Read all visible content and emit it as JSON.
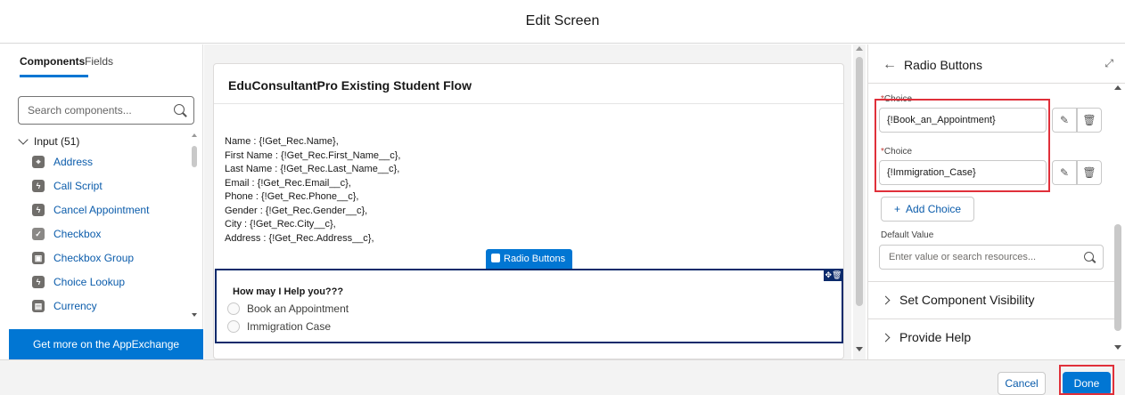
{
  "modal": {
    "title": "Edit Screen"
  },
  "left_panel": {
    "tabs": [
      {
        "label": "Components"
      },
      {
        "label": "Fields"
      }
    ],
    "search": {
      "placeholder": "Search components..."
    },
    "group": {
      "label": "Input (51)"
    },
    "items": [
      {
        "label": "Address",
        "icon": "address-icon"
      },
      {
        "label": "Call Script",
        "icon": "lightning-icon"
      },
      {
        "label": "Cancel Appointment",
        "icon": "lightning-icon"
      },
      {
        "label": "Checkbox",
        "icon": "checkbox-icon"
      },
      {
        "label": "Checkbox Group",
        "icon": "checkbox-group-icon"
      },
      {
        "label": "Choice Lookup",
        "icon": "lightning-icon"
      },
      {
        "label": "Currency",
        "icon": "currency-icon"
      }
    ],
    "appexchange_label": "Get more on the AppExchange"
  },
  "canvas": {
    "card_title": "EduConsultantPro Existing Student Flow",
    "display_lines": [
      "Name : {!Get_Rec.Name},",
      "First Name : {!Get_Rec.First_Name__c},",
      "Last Name : {!Get_Rec.Last_Name__c},",
      "Email : {!Get_Rec.Email__c},",
      "Phone : {!Get_Rec.Phone__c},",
      "Gender : {!Get_Rec.Gender__c},",
      "City : {!Get_Rec.City__c},",
      "Address : {!Get_Rec.Address__c},"
    ],
    "radio_tag": "Radio Buttons",
    "radio_question": "How may I Help you???",
    "radio_options": [
      "Book an Appointment",
      "Immigration Case"
    ]
  },
  "right_panel": {
    "title": "Radio Buttons",
    "choice_label": "Choice",
    "choices": [
      "{!Book_an_Appointment}",
      "{!Immigration_Case}"
    ],
    "add_choice_label": "Add Choice",
    "default_value_label": "Default Value",
    "default_value_placeholder": "Enter value or search resources...",
    "sections": [
      "Set Component Visibility",
      "Provide Help"
    ]
  },
  "footer": {
    "cancel_label": "Cancel",
    "done_label": "Done"
  },
  "colors": {
    "brand": "#0176d3",
    "highlight": "#e0303a",
    "selected_border": "#0b2a6b"
  }
}
